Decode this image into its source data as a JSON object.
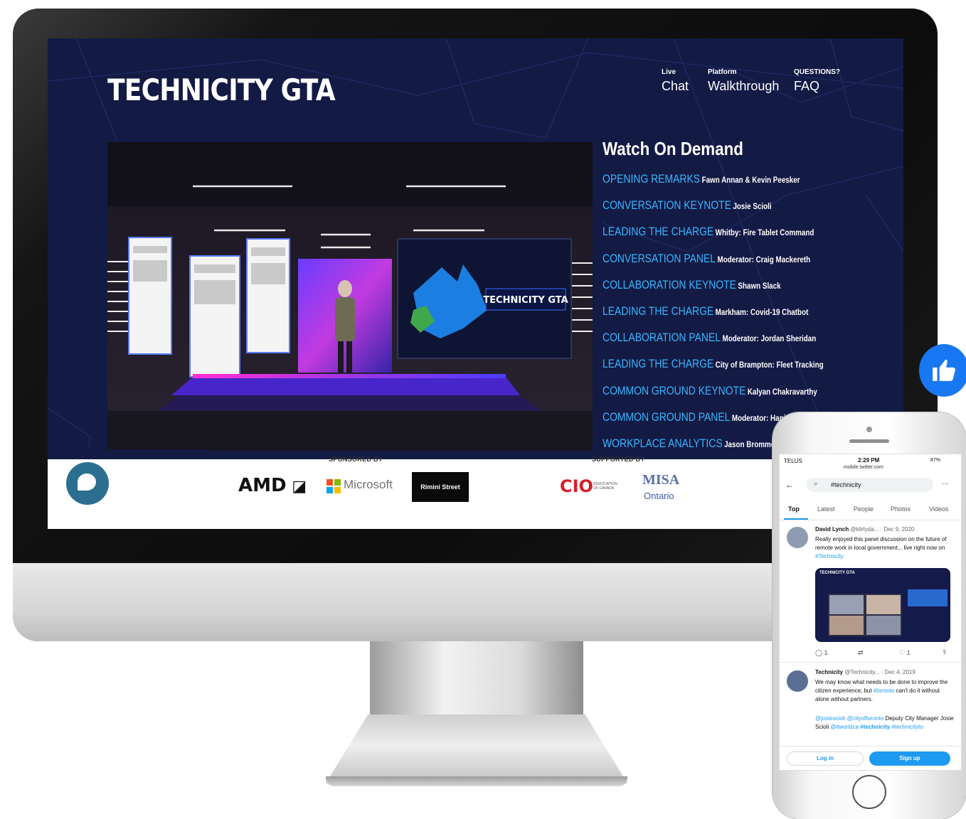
{
  "site": {
    "title": "TECHNICITY GTA",
    "nav": [
      {
        "small": "Live",
        "big": "Chat"
      },
      {
        "small": "Platform",
        "big": "Walkthrough"
      },
      {
        "small": "QUESTIONS?",
        "big": "FAQ"
      }
    ],
    "stage_screen_logo": "TECHNICITY GTA",
    "on_demand": {
      "heading": "Watch On Demand",
      "items": [
        {
          "title": "OPENING REMARKS",
          "sub": "Fawn Annan & Kevin Peesker"
        },
        {
          "title": "CONVERSATION KEYNOTE",
          "sub": "Josie Scioli"
        },
        {
          "title": "LEADING THE CHARGE",
          "sub": "Whitby: Fire Tablet Command"
        },
        {
          "title": "CONVERSATION PANEL",
          "sub": "Moderator: Craig Mackereth"
        },
        {
          "title": "COLLABORATION KEYNOTE",
          "sub": "Shawn Slack"
        },
        {
          "title": "LEADING THE CHARGE",
          "sub": "Markham: Covid-19 Chatbot"
        },
        {
          "title": "COLLABORATION PANEL",
          "sub": "Moderator: Jordan Sheridan"
        },
        {
          "title": "LEADING THE CHARGE",
          "sub": "City of Brampton: Fleet Tracking"
        },
        {
          "title": "COMMON GROUND KEYNOTE",
          "sub": "Kalyan Chakravarthy"
        },
        {
          "title": "COMMON GROUND PANEL",
          "sub": "Moderator: Hani"
        },
        {
          "title": "WORKPLACE ANALYTICS",
          "sub": "Jason Brommet"
        }
      ]
    },
    "sponsors": {
      "sponsored_label": "SPONSORED BY",
      "supported_label": "SUPPORTED BY",
      "amd": "AMD",
      "microsoft": "Microsoft",
      "rimini": "Rimini Street",
      "cio": "CIO",
      "cio_sub1": "ASSOCIATION",
      "cio_sub2": "OF CANADA",
      "misa": "MISA",
      "misa_sub": "Ontario"
    }
  },
  "phone": {
    "carrier": "TELUS",
    "time": "2:29 PM",
    "battery": "87%",
    "url": "mobile.twitter.com",
    "search": "#technicity",
    "tabs": [
      "Top",
      "Latest",
      "People",
      "Photos",
      "Videos"
    ],
    "tweet1": {
      "name": "David Lynch",
      "handle": "@klirlyda...",
      "date": "· Dec 9, 2020",
      "text": "Really enjoyed this panel discussion on the future of remote work in local government... live right now on",
      "hashtag": "#Technicity",
      "media_title": "TECHNICITY GTA",
      "replies": "1",
      "likes": "1"
    },
    "tweet2": {
      "name": "Technicity",
      "handle": "@Technicity...",
      "date": "· Dec 4, 2019",
      "text_a": "We may know what needs to be done to improve the citizen experience, but",
      "hashtag_a": "#toronto",
      "text_b": "can't do it without alone without partners.",
      "mentions": "@josiescioli @cityoftoronto",
      "text_c": "Deputy City Manager Josie Scioli",
      "mentions2": "@itworldca",
      "hashtag_b": "#technicity",
      "hashtag_c": "#technicityto"
    },
    "login": "Log in",
    "signup": "Sign up"
  },
  "colors": {
    "screen_bg": "#131a44",
    "accent_blue": "#37b6ff",
    "twitter_blue": "#1d9bf0",
    "like_blue": "#1877f2"
  }
}
